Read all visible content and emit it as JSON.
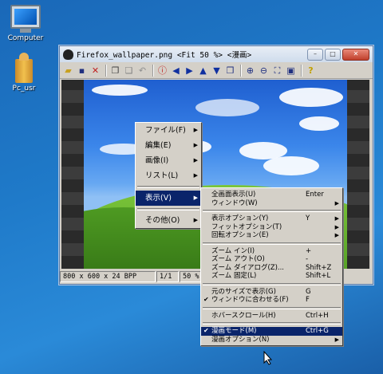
{
  "desktop": {
    "icons": [
      {
        "label": "Computer",
        "icon": "computer-icon"
      },
      {
        "label": "Pc_usr",
        "icon": "user-folder-icon"
      }
    ]
  },
  "window": {
    "title": "Firefox_wallpaper.png <Fit 50 %> <漫画>",
    "controls": {
      "minimize": "–",
      "maximize": "□",
      "close": "✕"
    },
    "toolbar_icons": [
      "open-folder-icon",
      "save-icon",
      "delete-icon",
      "copy-icon",
      "paste-icon",
      "undo-icon",
      "info-icon",
      "arrow-left-icon",
      "arrow-right-icon",
      "arrow-up-icon",
      "arrow-down-icon",
      "window-icon",
      "zoom-in-icon",
      "zoom-out-icon",
      "fit-icon",
      "fullscreen-icon",
      "help-icon"
    ],
    "status": {
      "dimensions": "800 x 600 x 24 BPP",
      "page": "1/1",
      "zoom": "50 %"
    }
  },
  "context_menu": {
    "items": [
      {
        "label": "ファイル(F)"
      },
      {
        "label": "編集(E)"
      },
      {
        "label": "画像(I)"
      },
      {
        "label": "リスト(L)"
      },
      {
        "label": "表示(V)"
      },
      {
        "label": "その他(O)"
      }
    ]
  },
  "view_submenu": {
    "items": [
      {
        "label": "全画面表示(U)",
        "shortcut": "Enter"
      },
      {
        "label": "ウィンドウ(W)",
        "shortcut": ""
      },
      {
        "label": "表示オプション(Y)",
        "shortcut": "Y"
      },
      {
        "label": "フィットオプション(T)",
        "shortcut": ""
      },
      {
        "label": "回転オプション(E)",
        "shortcut": ""
      },
      {
        "label": "ズーム イン(I)",
        "shortcut": "+"
      },
      {
        "label": "ズーム アウト(O)",
        "shortcut": "-"
      },
      {
        "label": "ズーム ダイアログ(Z)...",
        "shortcut": "Shift+Z"
      },
      {
        "label": "ズーム 固定(L)",
        "shortcut": "Shift+L"
      },
      {
        "label": "元のサイズで表示(G)",
        "shortcut": "G"
      },
      {
        "label": "ウィンドウに合わせる(F)",
        "shortcut": "F"
      },
      {
        "label": "ホバースクロール(H)",
        "shortcut": "Ctrl+H"
      },
      {
        "label": "漫画モード(M)",
        "shortcut": "Ctrl+G"
      },
      {
        "label": "漫画オプション(N)",
        "shortcut": ""
      }
    ]
  }
}
